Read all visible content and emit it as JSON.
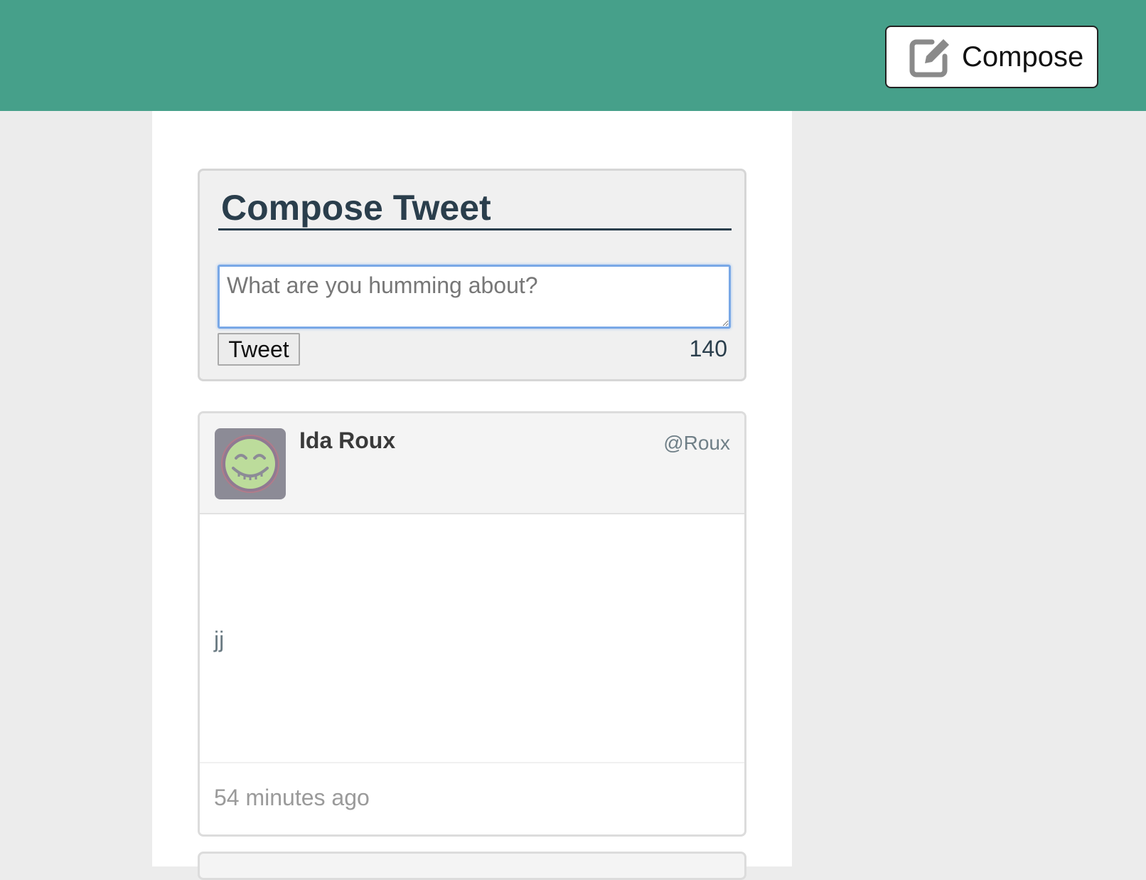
{
  "header": {
    "compose_label": "Compose",
    "background_color": "#46a08a",
    "compose_icon": "edit-icon"
  },
  "compose_form": {
    "title": "Compose Tweet",
    "placeholder": "What are you humming about?",
    "value": "",
    "submit_label": "Tweet",
    "char_count": "140"
  },
  "tweets": [
    {
      "name": "Ida Roux",
      "handle": "@Roux",
      "avatar_icon": "smiley-icon",
      "text": "jj",
      "timestamp": "54 minutes ago"
    }
  ]
}
